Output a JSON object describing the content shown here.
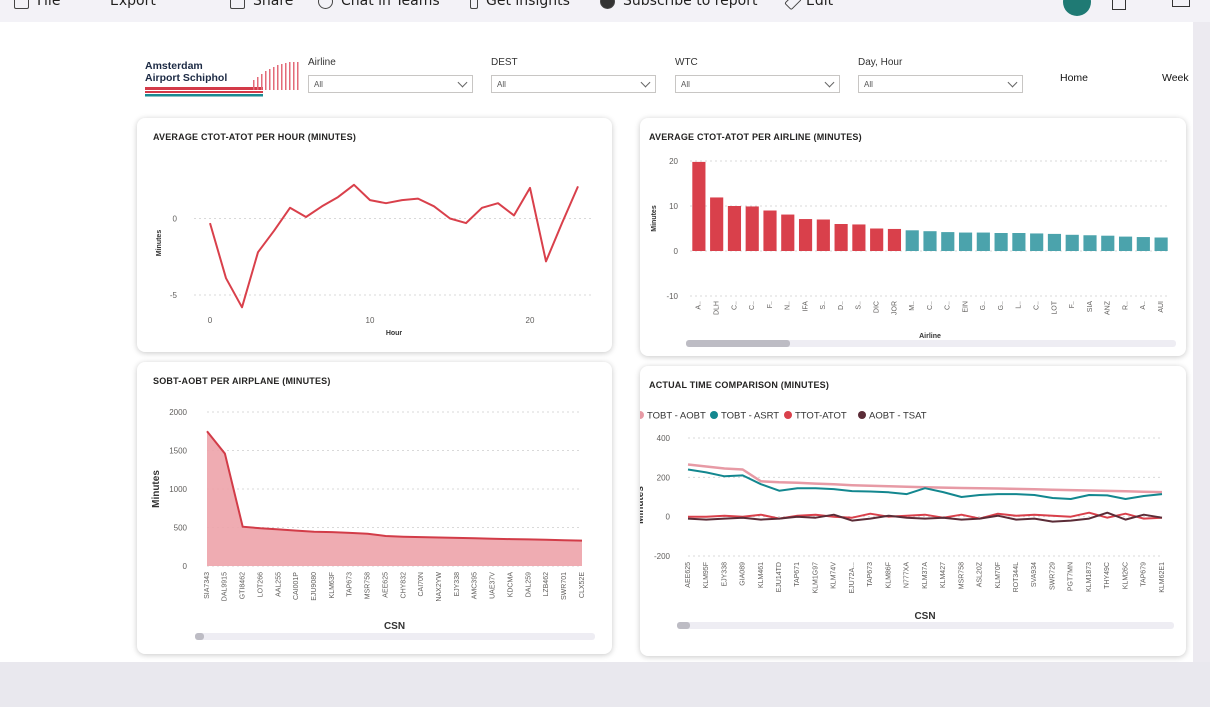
{
  "toolbar": {
    "items": [
      "File",
      "Export",
      "Share",
      "Chat in Teams",
      "Get insights",
      "Subscribe to report",
      "Edit"
    ]
  },
  "logo": {
    "line1": "Amsterdam",
    "line2": "Airport Schiphol"
  },
  "filters": [
    {
      "label": "Airline",
      "value": "All"
    },
    {
      "label": "DEST",
      "value": "All"
    },
    {
      "label": "WTC",
      "value": "All"
    },
    {
      "label": "Day, Hour",
      "value": "All"
    }
  ],
  "nav": {
    "home": "Home",
    "week": "Week"
  },
  "colors": {
    "red": "#d9404b",
    "teal": "#4ba3ac",
    "pink": "#e79aa5",
    "dark_teal": "#13878f",
    "maroon": "#5b2c37",
    "area_fill": "#eda3aa"
  },
  "chart_data": [
    {
      "type": "line",
      "title": "AVERAGE CTOT-ATOT PER HOUR (MINUTES)",
      "xlabel": "Hour",
      "ylabel": "Minutes",
      "x_ticks": [
        "0",
        "10",
        "20"
      ],
      "y_ticks": [
        "0",
        "-5"
      ],
      "xlim": [
        -1,
        24
      ],
      "ylim": [
        -6.5,
        3.3
      ],
      "grid": true,
      "x": [
        0,
        1,
        2,
        3,
        4,
        5,
        6,
        7,
        8,
        9,
        10,
        11,
        12,
        13,
        14,
        15,
        16,
        17,
        18,
        19,
        20,
        21,
        22,
        23
      ],
      "values": [
        -0.3,
        -3.9,
        -5.8,
        -2.2,
        -0.8,
        0.7,
        0.1,
        0.8,
        1.4,
        2.2,
        1.2,
        1.0,
        1.2,
        1.3,
        0.8,
        0.0,
        -0.3,
        0.7,
        1.0,
        0.2,
        2.0,
        -2.8,
        -0.3,
        2.1
      ]
    },
    {
      "type": "bar",
      "title": "AVERAGE CTOT-ATOT PER AIRLINE (MINUTES)",
      "xlabel": "Airline",
      "ylabel": "Minutes",
      "y_ticks": [
        "20",
        "10",
        "0",
        "-10"
      ],
      "ylim": [
        -10,
        20
      ],
      "grid": true,
      "categories": [
        "A..",
        "DLH",
        "C..",
        "C..",
        "F..",
        "N..",
        "IFA",
        "S..",
        "D..",
        "S..",
        "DIC",
        "JOR",
        "M..",
        "C..",
        "C..",
        "EIN",
        "G..",
        "G..",
        "L..",
        "C..",
        "LOT",
        "F..",
        "SIA",
        "ANZ",
        "R..",
        "A..",
        "AUI"
      ],
      "values": [
        19.8,
        11.9,
        10.0,
        9.9,
        9.0,
        8.1,
        7.1,
        7.0,
        6.0,
        5.9,
        5.0,
        4.9,
        4.6,
        4.4,
        4.2,
        4.1,
        4.1,
        4.0,
        4.0,
        3.9,
        3.8,
        3.6,
        3.5,
        3.4,
        3.2,
        3.1,
        3.0
      ],
      "highlighted_count": 12
    },
    {
      "type": "area",
      "title": "SOBT-AOBT PER AIRPLANE (MINUTES)",
      "xlabel": "CSN",
      "ylabel": "Minutes",
      "y_ticks": [
        "2000",
        "1500",
        "1000",
        "500",
        "0"
      ],
      "ylim": [
        0,
        2000
      ],
      "grid": true,
      "categories": [
        "SIA7343",
        "DAL9915",
        "GTI8462",
        "LOT266",
        "AAL255",
        "CAI001P",
        "EJU9080",
        "KLM63F",
        "TAP673",
        "MSR758",
        "AEE625",
        "CHY832",
        "CAI70N",
        "NAX2YW",
        "EJY338",
        "AMC395",
        "UAE37V",
        "KDCMA",
        "DAL259",
        "LZB462",
        "SWR701",
        "CLX52E"
      ],
      "values": [
        1750,
        1460,
        510,
        490,
        475,
        460,
        445,
        440,
        430,
        420,
        390,
        380,
        375,
        370,
        365,
        360,
        355,
        350,
        345,
        340,
        335,
        330
      ]
    },
    {
      "type": "line",
      "title": "ACTUAL TIME COMPARISON (MINUTES)",
      "xlabel": "CSN",
      "ylabel": "Minutes",
      "y_ticks": [
        "400",
        "200",
        "0",
        "-200"
      ],
      "ylim": [
        -200,
        400
      ],
      "grid": true,
      "legend_position": "top-left",
      "categories": [
        "AEE625",
        "KLM95F",
        "EJY338",
        "GIA089",
        "KLM461",
        "EJU14TD",
        "TAP671",
        "KLM1G97",
        "KLM74V",
        "EJU72A...",
        "TAP673",
        "KLM86F",
        "N777XA",
        "KLM37A",
        "KLM427",
        "MSR758",
        "ASL20Z",
        "KLM70F",
        "ROT344L",
        "SVA934",
        "SWR729",
        "PGT7MN",
        "KLM1873",
        "THY49C",
        "KLM26C",
        "TAP679",
        "KLM62E1"
      ],
      "series": [
        {
          "name": "TOBT - AOBT",
          "values": [
            265,
            255,
            245,
            240,
            180,
            175,
            172,
            168,
            165,
            160,
            157,
            155,
            152,
            150,
            148,
            146,
            145,
            143,
            141,
            139,
            137,
            135,
            133,
            131,
            129,
            127,
            125
          ]
        },
        {
          "name": "TOBT - ASRT",
          "values": [
            240,
            225,
            205,
            210,
            165,
            132,
            145,
            145,
            140,
            130,
            128,
            124,
            115,
            145,
            125,
            100,
            110,
            115,
            115,
            110,
            95,
            90,
            110,
            108,
            90,
            105,
            115
          ]
        },
        {
          "name": "TTOT-ATOT",
          "values": [
            0,
            0,
            5,
            0,
            10,
            -10,
            5,
            10,
            0,
            -5,
            15,
            0,
            5,
            10,
            -5,
            10,
            -10,
            15,
            5,
            10,
            5,
            0,
            20,
            -5,
            15,
            -10,
            -5
          ]
        },
        {
          "name": "AOBT - TSAT",
          "values": [
            -10,
            -15,
            -10,
            -5,
            -15,
            -10,
            0,
            -5,
            10,
            -20,
            -10,
            5,
            -5,
            -10,
            -5,
            -15,
            -10,
            5,
            -15,
            -10,
            -25,
            -20,
            -10,
            20,
            -15,
            10,
            -5
          ]
        }
      ]
    }
  ]
}
